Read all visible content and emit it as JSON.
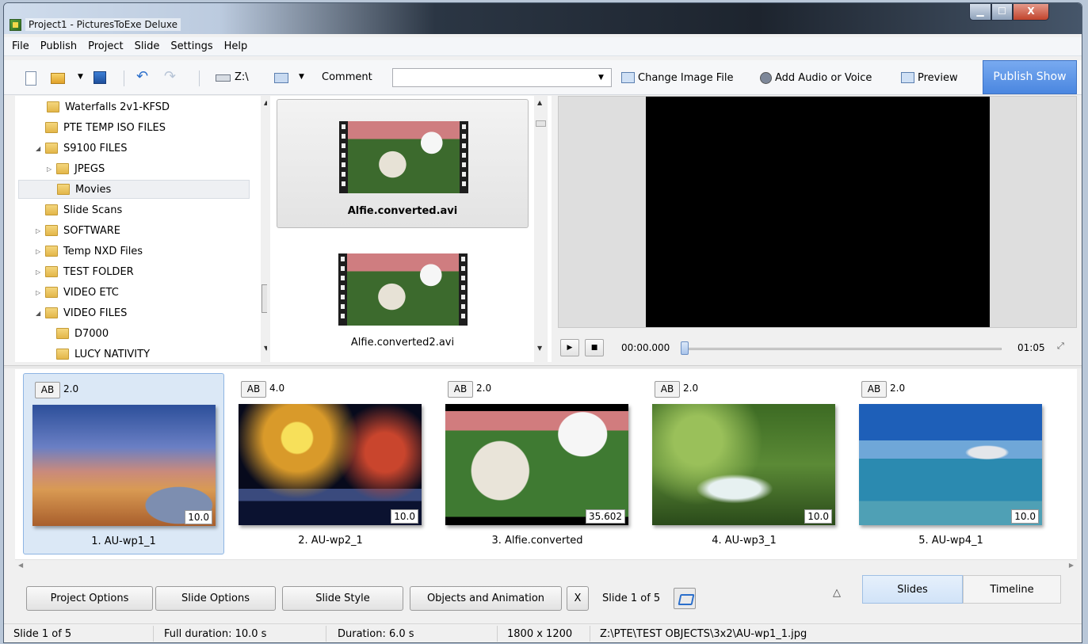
{
  "window": {
    "title": "Project1 - PicturesToExe Deluxe",
    "minimize": "▁",
    "maximize": "☐",
    "close": "X"
  },
  "menu": [
    "File",
    "Publish",
    "Project",
    "Slide",
    "Settings",
    "Help"
  ],
  "toolbar": {
    "drive": "Z:\\",
    "comment_label": "Comment",
    "comment_value": "",
    "change_image": "Change Image File",
    "add_audio": "Add Audio or Voice",
    "preview": "Preview",
    "publish": "Publish Show",
    "undo_glyph": "↶",
    "redo_glyph": "↷",
    "dropdown_glyph": "▼"
  },
  "tree": [
    {
      "label": "Waterfalls 2v1-KFSD",
      "indent": 2,
      "expander": ""
    },
    {
      "label": "PTE TEMP ISO FILES",
      "indent": 1,
      "expander": ""
    },
    {
      "label": "S9100 FILES",
      "indent": 1,
      "expander": "◢"
    },
    {
      "label": "JPEGS",
      "indent": 2,
      "expander": "▷"
    },
    {
      "label": "Movies",
      "indent": 2,
      "expander": "",
      "selected": true
    },
    {
      "label": "Slide Scans",
      "indent": 1,
      "expander": ""
    },
    {
      "label": "SOFTWARE",
      "indent": 1,
      "expander": "▷"
    },
    {
      "label": "Temp NXD Files",
      "indent": 1,
      "expander": "▷"
    },
    {
      "label": "TEST FOLDER",
      "indent": 1,
      "expander": "▷"
    },
    {
      "label": "VIDEO ETC",
      "indent": 1,
      "expander": "▷"
    },
    {
      "label": "VIDEO FILES",
      "indent": 1,
      "expander": "◢"
    },
    {
      "label": "D7000",
      "indent": 2,
      "expander": ""
    },
    {
      "label": "LUCY NATIVITY",
      "indent": 2,
      "expander": ""
    }
  ],
  "files": [
    {
      "name": "Alfie.converted.avi",
      "selected": true
    },
    {
      "name": "Alfie.converted2.avi",
      "selected": false
    }
  ],
  "player": {
    "play": "▶",
    "stop": "■",
    "current_time": "00:00.000",
    "total_time": "01:05",
    "fullscreen": "⤢"
  },
  "slides": [
    {
      "transition": "AB",
      "transition_duration": "2.0",
      "duration": "10.0",
      "name": "1. AU-wp1_1",
      "selected": true
    },
    {
      "transition": "AB",
      "transition_duration": "4.0",
      "duration": "10.0",
      "name": "2. AU-wp2_1",
      "selected": false
    },
    {
      "transition": "AB",
      "transition_duration": "2.0",
      "duration": "35.602",
      "name": "3. Alfie.converted",
      "selected": false
    },
    {
      "transition": "AB",
      "transition_duration": "2.0",
      "duration": "10.0",
      "name": "4. AU-wp3_1",
      "selected": false
    },
    {
      "transition": "AB",
      "transition_duration": "2.0",
      "duration": "10.0",
      "name": "5. AU-wp4_1",
      "selected": false
    }
  ],
  "bottom": {
    "project_options": "Project Options",
    "slide_options": "Slide Options",
    "slide_style": "Slide Style",
    "objects_animation": "Objects and Animation",
    "close_x": "X",
    "slide_counter": "Slide 1 of 5",
    "collapse_glyph": "△",
    "tab_slides": "Slides",
    "tab_timeline": "Timeline"
  },
  "status": {
    "slide": "Slide 1 of 5",
    "full_duration": "Full duration: 10.0 s",
    "duration": "Duration: 6.0 s",
    "resolution": "1800 x 1200",
    "path": "Z:\\PTE\\TEST OBJECTS\\3x2\\AU-wp1_1.jpg"
  }
}
